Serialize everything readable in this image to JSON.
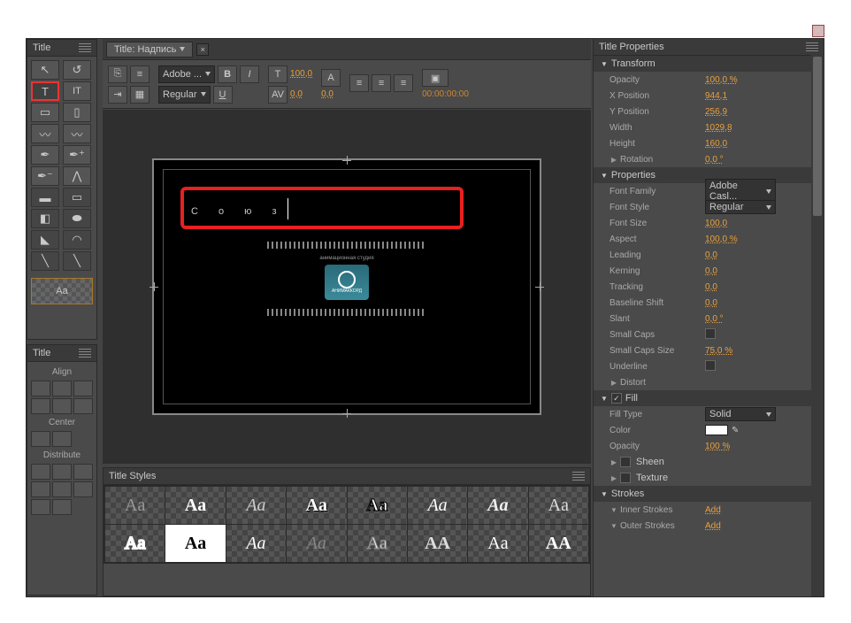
{
  "window": {
    "close": "×"
  },
  "tools_panel": {
    "tab": "Title",
    "preview": "Aa"
  },
  "doc_tab": {
    "label": "Title: Надпись"
  },
  "format_bar": {
    "font_family": "Adobe ...",
    "font_style": "Regular",
    "bold": "B",
    "italic": "I",
    "underline": "U",
    "size_icon": "T",
    "size_value": "100,0",
    "kerning_value": "0,0",
    "leading_value": "0,0",
    "aspect_icon": "A",
    "timecode": "00:00:00:00"
  },
  "canvas": {
    "text": "С о ю з",
    "credit": "анимационная студия",
    "logo_label": "АНИМАККОРД"
  },
  "align_panel": {
    "tab": "Title",
    "align_head": "Align",
    "center_head": "Center",
    "distribute_head": "Distribute"
  },
  "styles_panel": {
    "tab": "Title Styles",
    "swatches": [
      "Aa",
      "Aa",
      "Aa",
      "Aa",
      "Aa",
      "Aa",
      "Aa",
      "Aa",
      "Aa",
      "Aa",
      "Aa",
      "Aa",
      "Aa",
      "AA",
      "Aa",
      "AA"
    ]
  },
  "props": {
    "tab": "Title Properties",
    "sections": {
      "transform": {
        "head": "Transform",
        "opacity_l": "Opacity",
        "opacity_v": "100,0 %",
        "xpos_l": "X Position",
        "xpos_v": "944,1",
        "ypos_l": "Y Position",
        "ypos_v": "256,9",
        "width_l": "Width",
        "width_v": "1029,8",
        "height_l": "Height",
        "height_v": "160,0",
        "rotation_l": "Rotation",
        "rotation_v": "0,0 °"
      },
      "properties": {
        "head": "Properties",
        "ff_l": "Font Family",
        "ff_v": "Adobe Casl...",
        "fs_l": "Font Style",
        "fs_v": "Regular",
        "size_l": "Font Size",
        "size_v": "100,0",
        "aspect_l": "Aspect",
        "aspect_v": "100,0 %",
        "leading_l": "Leading",
        "leading_v": "0,0",
        "kerning_l": "Kerning",
        "kerning_v": "0,0",
        "tracking_l": "Tracking",
        "tracking_v": "0,0",
        "baseline_l": "Baseline Shift",
        "baseline_v": "0,0",
        "slant_l": "Slant",
        "slant_v": "0,0 °",
        "smallcaps_l": "Small Caps",
        "smallcapssize_l": "Small Caps Size",
        "smallcapssize_v": "75,0 %",
        "underline_l": "Underline",
        "distort_l": "Distort"
      },
      "fill": {
        "head": "Fill",
        "filltype_l": "Fill Type",
        "filltype_v": "Solid",
        "color_l": "Color",
        "opacity_l": "Opacity",
        "opacity_v": "100 %",
        "sheen_l": "Sheen",
        "texture_l": "Texture"
      },
      "strokes": {
        "head": "Strokes",
        "inner_l": "Inner Strokes",
        "inner_v": "Add",
        "outer_l": "Outer Strokes",
        "outer_v": "Add"
      }
    }
  }
}
